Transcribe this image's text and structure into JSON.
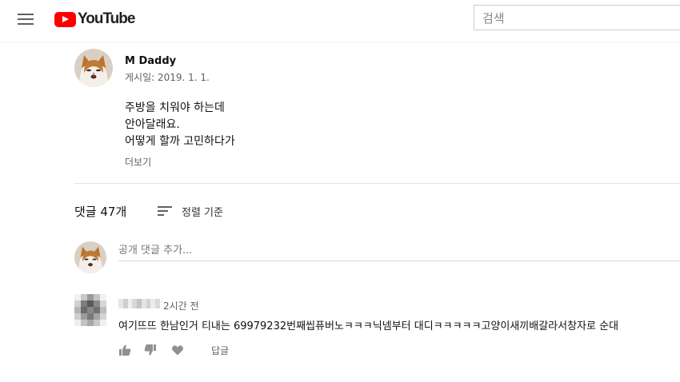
{
  "header": {
    "logo_text": "YouTube",
    "search_placeholder": "검색"
  },
  "video": {
    "channel_name": "M Daddy",
    "published": "게시일: 2019. 1. 1.",
    "description": [
      "주방을 치워야 하는데",
      "안아달래요.",
      "어떻게 할까 고민하다가"
    ],
    "more_label": "더보기"
  },
  "comments": {
    "count_label": "댓글 47개",
    "sort_label": "정렬 기준",
    "add_placeholder": "공개 댓글 추가...",
    "items": [
      {
        "time": "2시간 전",
        "text": "여기뜨뜨 한남인거 티내는 69979232번째씹퓨버노ㅋㅋㅋ닉넴부터 대디ㅋㅋㅋㅋㅋ고양이새끼배갈라서창자로 순대",
        "reply_label": "답글"
      }
    ]
  },
  "icons": {
    "menu": "menu-icon",
    "like": "thumbs-up-icon",
    "dislike": "thumbs-down-icon",
    "heart": "heart-icon",
    "sort": "sort-icon"
  },
  "colors": {
    "brand_red": "#ff0000",
    "text_secondary": "#606060"
  }
}
